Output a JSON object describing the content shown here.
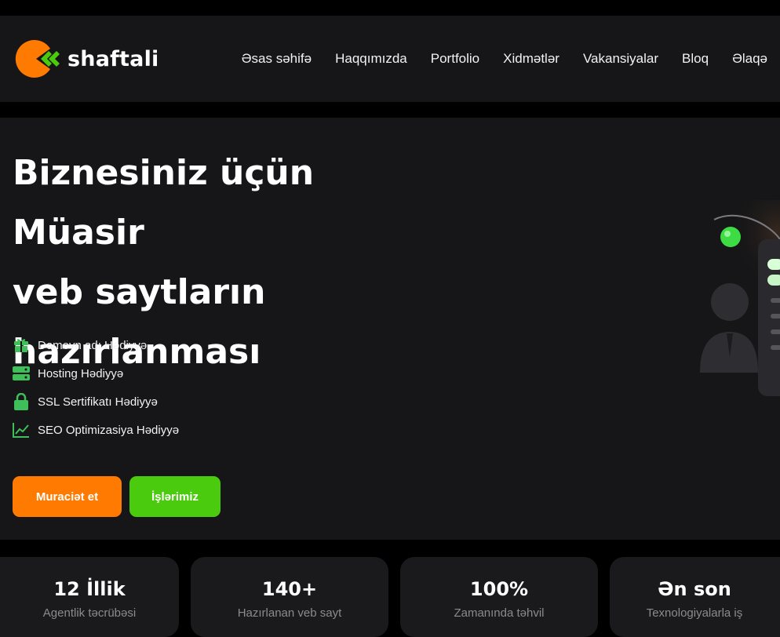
{
  "brand": {
    "name": "shaftali",
    "logo_orange": "#ff7a00",
    "logo_green": "#4bcb0e"
  },
  "nav": {
    "items": [
      {
        "label": "Əsas səhifə"
      },
      {
        "label": "Haqqımızda"
      },
      {
        "label": "Portfolio"
      },
      {
        "label": "Xidmətlər"
      },
      {
        "label": "Vakansiyalar"
      },
      {
        "label": "Bloq"
      },
      {
        "label": "Əlaqə"
      }
    ]
  },
  "hero": {
    "title_lines": [
      "Biznesiniz üçün Müasir",
      "veb saytların",
      "hazırlanması"
    ],
    "features": [
      {
        "icon": "gift-icon",
        "label": "Domeyn adı Hədiyyə"
      },
      {
        "icon": "server-icon",
        "label": "Hosting Hədiyyə"
      },
      {
        "icon": "lock-icon",
        "label": "SSL Sertifikatı Hədiyyə"
      },
      {
        "icon": "chart-line-icon",
        "label": "SEO Optimizasiya Hədiyyə"
      }
    ],
    "buttons": {
      "apply": "Muraciət et",
      "works": "İşlərimiz"
    }
  },
  "stats": [
    {
      "value": "12 İllik",
      "label": "Agentlik təcrübəsi"
    },
    {
      "value": "140+",
      "label": "Hazırlanan veb sayt"
    },
    {
      "value": "100%",
      "label": "Zamanında təhvil"
    },
    {
      "value": "Ən son",
      "label": "Texnologiyalarla iş"
    }
  ],
  "colors": {
    "accent_orange": "#ff7a00",
    "accent_green": "#4bcb0e",
    "icon_green": "#3fbf5a",
    "panel_bg": "#161618",
    "page_bg": "#000000"
  }
}
